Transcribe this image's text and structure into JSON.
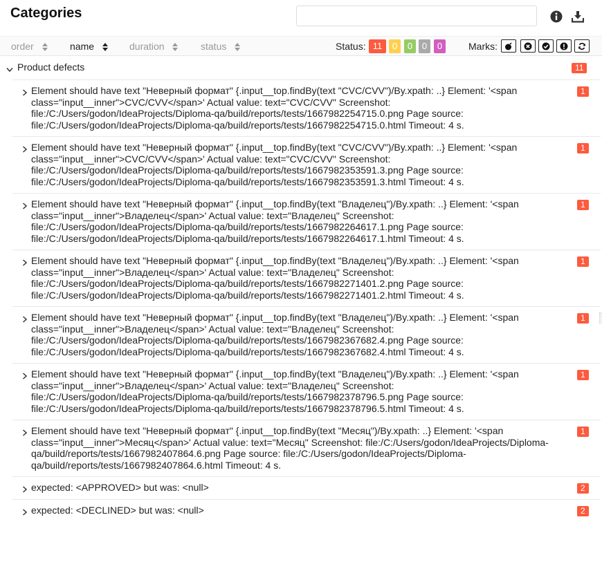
{
  "header": {
    "title": "Categories",
    "search_value": "",
    "search_placeholder": "",
    "info_icon": "info-circle-icon",
    "download_icon": "download-icon"
  },
  "sort": {
    "columns": [
      {
        "label": "order",
        "active": false
      },
      {
        "label": "name",
        "active": true
      },
      {
        "label": "duration",
        "active": false
      },
      {
        "label": "status",
        "active": false
      }
    ],
    "status_label": "Status:",
    "status_badges": [
      {
        "value": "11",
        "color": "#fd5a3e",
        "name": "failed"
      },
      {
        "value": "0",
        "color": "#ffd050",
        "name": "broken"
      },
      {
        "value": "0",
        "color": "#97cc64",
        "name": "passed"
      },
      {
        "value": "0",
        "color": "#aaaaaa",
        "name": "skipped"
      },
      {
        "value": "0",
        "color": "#d35ebe",
        "name": "unknown"
      }
    ],
    "marks_label": "Marks:",
    "marks": [
      "flaky-bomb-icon",
      "new-failed-icon",
      "new-passed-icon",
      "new-broken-icon",
      "retries-icon"
    ]
  },
  "group": {
    "name": "Product defects",
    "count": "11"
  },
  "items": [
    {
      "text": "Element should have text \"Неверный формат\" {.input__top.findBy(text \"CVC/CVV\")/By.xpath: ..} Element: '<span class=\"input__inner\">CVC/CVV</span>' Actual value: text=\"CVC/CVV\" Screenshot: file:/C:/Users/godon/IdeaProjects/Diploma-qa/build/reports/tests/1667982254715.0.png Page source: file:/C:/Users/godon/IdeaProjects/Diploma-qa/build/reports/tests/1667982254715.0.html Timeout: 4 s.",
      "count": "1"
    },
    {
      "text": "Element should have text \"Неверный формат\" {.input__top.findBy(text \"CVC/CVV\")/By.xpath: ..} Element: '<span class=\"input__inner\">CVC/CVV</span>' Actual value: text=\"CVC/CVV\" Screenshot: file:/C:/Users/godon/IdeaProjects/Diploma-qa/build/reports/tests/1667982353591.3.png Page source: file:/C:/Users/godon/IdeaProjects/Diploma-qa/build/reports/tests/1667982353591.3.html Timeout: 4 s.",
      "count": "1"
    },
    {
      "text": "Element should have text \"Неверный формат\" {.input__top.findBy(text \"Владелец\")/By.xpath: ..} Element: '<span class=\"input__inner\">Владелец</span>' Actual value: text=\"Владелец\" Screenshot: file:/C:/Users/godon/IdeaProjects/Diploma-qa/build/reports/tests/1667982264617.1.png Page source: file:/C:/Users/godon/IdeaProjects/Diploma-qa/build/reports/tests/1667982264617.1.html Timeout: 4 s.",
      "count": "1"
    },
    {
      "text": "Element should have text \"Неверный формат\" {.input__top.findBy(text \"Владелец\")/By.xpath: ..} Element: '<span class=\"input__inner\">Владелец</span>' Actual value: text=\"Владелец\" Screenshot: file:/C:/Users/godon/IdeaProjects/Diploma-qa/build/reports/tests/1667982271401.2.png Page source: file:/C:/Users/godon/IdeaProjects/Diploma-qa/build/reports/tests/1667982271401.2.html Timeout: 4 s.",
      "count": "1"
    },
    {
      "text": "Element should have text \"Неверный формат\" {.input__top.findBy(text \"Владелец\")/By.xpath: ..} Element: '<span class=\"input__inner\">Владелец</span>' Actual value: text=\"Владелец\" Screenshot: file:/C:/Users/godon/IdeaProjects/Diploma-qa/build/reports/tests/1667982367682.4.png Page source: file:/C:/Users/godon/IdeaProjects/Diploma-qa/build/reports/tests/1667982367682.4.html Timeout: 4 s.",
      "count": "1"
    },
    {
      "text": "Element should have text \"Неверный формат\" {.input__top.findBy(text \"Владелец\")/By.xpath: ..} Element: '<span class=\"input__inner\">Владелец</span>' Actual value: text=\"Владелец\" Screenshot: file:/C:/Users/godon/IdeaProjects/Diploma-qa/build/reports/tests/1667982378796.5.png Page source: file:/C:/Users/godon/IdeaProjects/Diploma-qa/build/reports/tests/1667982378796.5.html Timeout: 4 s.",
      "count": "1"
    },
    {
      "text": "Element should have text \"Неверный формат\" {.input__top.findBy(text \"Месяц\")/By.xpath: ..} Element: '<span class=\"input__inner\">Месяц</span>' Actual value: text=\"Месяц\" Screenshot: file:/C:/Users/godon/IdeaProjects/Diploma-qa/build/reports/tests/1667982407864.6.png Page source: file:/C:/Users/godon/IdeaProjects/Diploma-qa/build/reports/tests/1667982407864.6.html Timeout: 4 s.",
      "count": "1"
    },
    {
      "text": "expected: <APPROVED> but was: <null>",
      "count": "2"
    },
    {
      "text": "expected: <DECLINED> but was: <null>",
      "count": "2"
    }
  ]
}
